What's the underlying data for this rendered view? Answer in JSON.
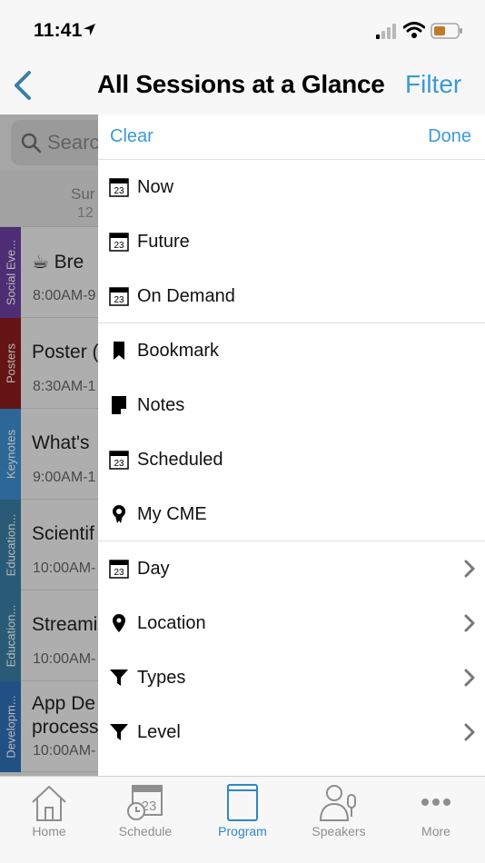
{
  "status": {
    "time": "11:41"
  },
  "nav": {
    "title": "All Sessions at a Glance",
    "filter_label": "Filter"
  },
  "search": {
    "placeholder": "Searc"
  },
  "day": {
    "name": "Sur",
    "number": "12"
  },
  "sessions": [
    {
      "category": "Social Eve...",
      "color": "#6b3fa0",
      "title": "☕ Bre",
      "time": "8:00AM-9"
    },
    {
      "category": "Posters",
      "color": "#8b1c1c",
      "title": "Poster (",
      "time": "8:30AM-1"
    },
    {
      "category": "Keynotes",
      "color": "#3d8fd1",
      "title": "What's",
      "time": "9:00AM-1"
    },
    {
      "category": "Education...",
      "color": "#3a7ea6",
      "title": "Scientif",
      "time": "10:00AM-"
    },
    {
      "category": "Education...",
      "color": "#3a7ea6",
      "title": "Streami",
      "time": "10:00AM-"
    },
    {
      "category": "Developm...",
      "color": "#2f6fb8",
      "title_line1": "App De",
      "title_line2": "process",
      "time": "10:00AM-"
    }
  ],
  "panel": {
    "clear_label": "Clear",
    "done_label": "Done",
    "options": [
      {
        "label": "Now",
        "icon": "calendar-icon"
      },
      {
        "label": "Future",
        "icon": "calendar-icon"
      },
      {
        "label": "On Demand",
        "icon": "calendar-icon"
      },
      {
        "label": "Bookmark",
        "icon": "bookmark-icon"
      },
      {
        "label": "Notes",
        "icon": "notes-icon"
      },
      {
        "label": "Scheduled",
        "icon": "calendar-icon"
      },
      {
        "label": "My CME",
        "icon": "award-icon"
      },
      {
        "label": "Day",
        "icon": "calendar-icon"
      },
      {
        "label": "Location",
        "icon": "location-pin-icon"
      },
      {
        "label": "Types",
        "icon": "funnel-icon"
      },
      {
        "label": "Level",
        "icon": "funnel-icon"
      }
    ],
    "calendar_icon_text": "23"
  },
  "tabs": [
    {
      "label": "Home",
      "icon": "home-icon"
    },
    {
      "label": "Schedule",
      "icon": "schedule-icon"
    },
    {
      "label": "Program",
      "icon": "program-book-icon",
      "active": true
    },
    {
      "label": "Speakers",
      "icon": "speaker-icon"
    },
    {
      "label": "More",
      "icon": "more-dots-icon"
    }
  ],
  "colors": {
    "accent": "#3a9ad9",
    "active_tab": "#2f87c4",
    "battery": "#c07a2a"
  }
}
